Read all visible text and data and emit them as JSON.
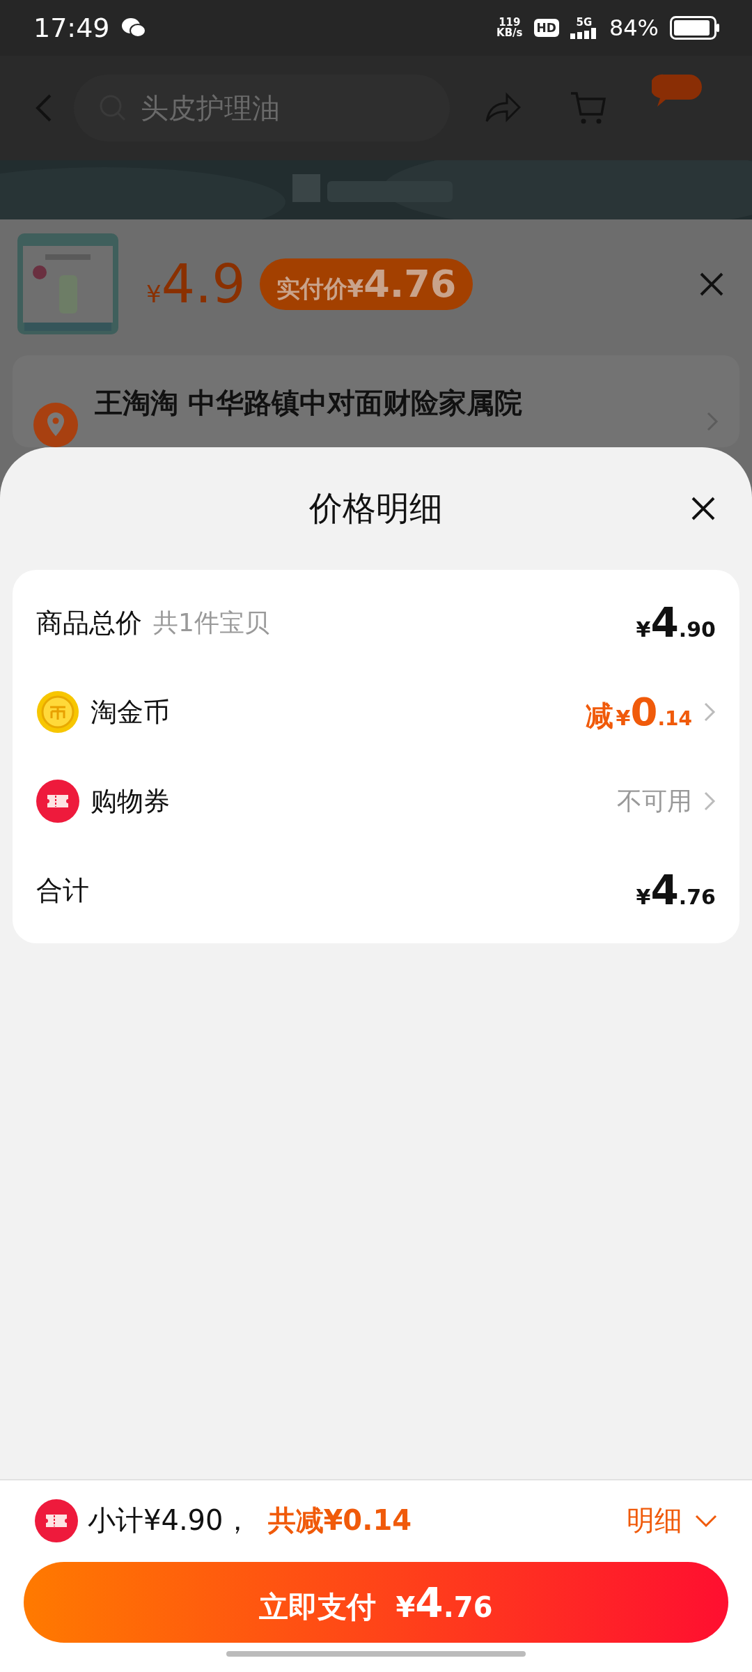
{
  "status_bar": {
    "time": "17:49",
    "net_speed": "119",
    "net_unit": "KB/s",
    "hd": "HD",
    "network": "5G",
    "battery": "84%"
  },
  "header": {
    "search": {
      "placeholder": "头皮护理油"
    }
  },
  "product": {
    "currency": "¥",
    "price": "4.9",
    "badge_label": "实付价",
    "badge_currency": "¥",
    "badge_price": "4.76"
  },
  "address": {
    "title": "王淘淘 中华路镇中对面财险家属院"
  },
  "sheet": {
    "title": "价格明细"
  },
  "rows": [
    {
      "kind": "total",
      "label": "商品总价",
      "note": "共1件宝贝",
      "currency": "¥",
      "integer": "4",
      "decimal": ".90"
    },
    {
      "kind": "coin",
      "label": "淘金币",
      "prefix": "减",
      "currency": "¥",
      "integer": "0",
      "decimal": ".14"
    },
    {
      "kind": "coupon",
      "label": "购物券",
      "status": "不可用"
    },
    {
      "kind": "sum",
      "label": "合计",
      "currency": "¥",
      "integer": "4",
      "decimal": ".76"
    }
  ],
  "footer": {
    "subtotal": "小计¥4.90，",
    "discount": "共减¥0.14",
    "detail": "明细",
    "pay": {
      "label": "立即支付",
      "currency": "¥",
      "integer": "4",
      "decimal": ".76"
    }
  }
}
